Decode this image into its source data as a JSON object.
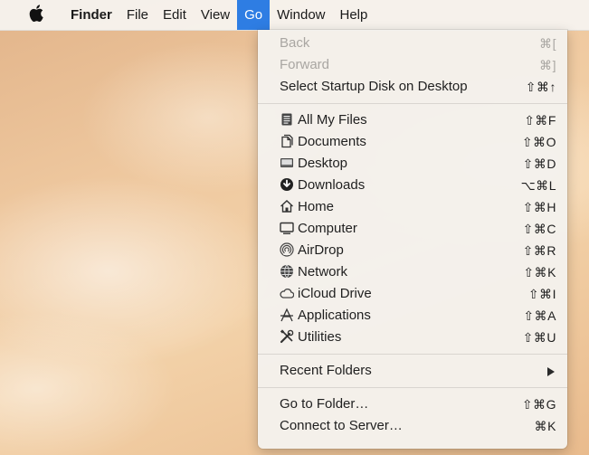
{
  "menubar": {
    "apple_icon": "apple-icon",
    "items": [
      "Finder",
      "File",
      "Edit",
      "View",
      "Go",
      "Window",
      "Help"
    ],
    "active_item": "Go"
  },
  "go_menu": {
    "nav": [
      {
        "label": "Back",
        "shortcut": "⌘[",
        "enabled": false
      },
      {
        "label": "Forward",
        "shortcut": "⌘]",
        "enabled": false
      },
      {
        "label": "Select Startup Disk on Desktop",
        "shortcut": "⇧⌘↑",
        "enabled": true
      }
    ],
    "places": [
      {
        "label": "All My Files",
        "shortcut": "⇧⌘F",
        "icon": "all-my-files-icon"
      },
      {
        "label": "Documents",
        "shortcut": "⇧⌘O",
        "icon": "documents-icon"
      },
      {
        "label": "Desktop",
        "shortcut": "⇧⌘D",
        "icon": "desktop-icon"
      },
      {
        "label": "Downloads",
        "shortcut": "⌥⌘L",
        "icon": "downloads-icon"
      },
      {
        "label": "Home",
        "shortcut": "⇧⌘H",
        "icon": "home-icon"
      },
      {
        "label": "Computer",
        "shortcut": "⇧⌘C",
        "icon": "computer-icon"
      },
      {
        "label": "AirDrop",
        "shortcut": "⇧⌘R",
        "icon": "airdrop-icon"
      },
      {
        "label": "Network",
        "shortcut": "⇧⌘K",
        "icon": "network-icon"
      },
      {
        "label": "iCloud Drive",
        "shortcut": "⇧⌘I",
        "icon": "icloud-icon"
      },
      {
        "label": "Applications",
        "shortcut": "⇧⌘A",
        "icon": "applications-icon"
      },
      {
        "label": "Utilities",
        "shortcut": "⇧⌘U",
        "icon": "utilities-icon"
      }
    ],
    "recent_folders": {
      "label": "Recent Folders",
      "submenu_icon": "submenu-arrow-icon"
    },
    "server": [
      {
        "label": "Go to Folder…",
        "shortcut": "⇧⌘G"
      },
      {
        "label": "Connect to Server…",
        "shortcut": "⌘K"
      }
    ]
  },
  "colors": {
    "menu_highlight": "#2e7de3",
    "disabled_text": "#a9a6a2",
    "menu_background": "#f4f1ed"
  }
}
